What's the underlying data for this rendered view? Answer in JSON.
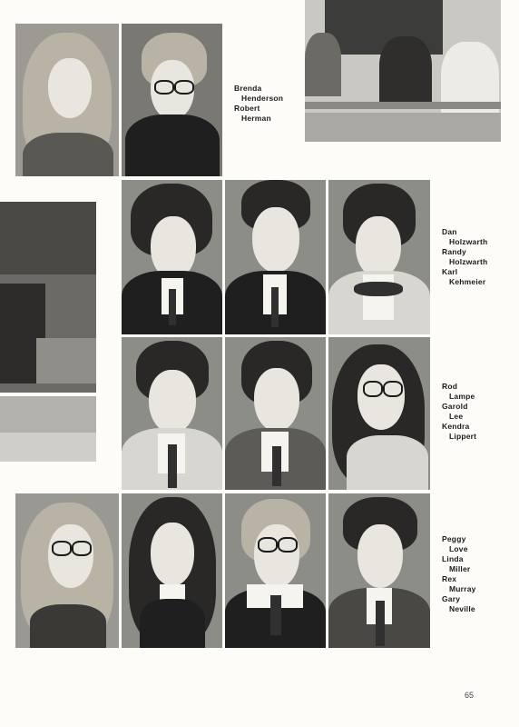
{
  "captions": [
    {
      "lines": [
        "Brenda",
        "Henderson",
        "Robert",
        "Herman"
      ]
    },
    {
      "lines": [
        "Dan",
        "Holzwarth",
        "Randy",
        "Holzwarth",
        "Karl",
        "Kehmeier"
      ]
    },
    {
      "lines": [
        "Rod",
        "Lampe",
        "Garold",
        "Lee",
        "Kendra",
        "Lippert"
      ]
    },
    {
      "lines": [
        "Peggy",
        "Love",
        "Linda",
        "Miller",
        "Rex",
        "Murray",
        "Gary",
        "Neville"
      ]
    }
  ],
  "page_number": "65"
}
